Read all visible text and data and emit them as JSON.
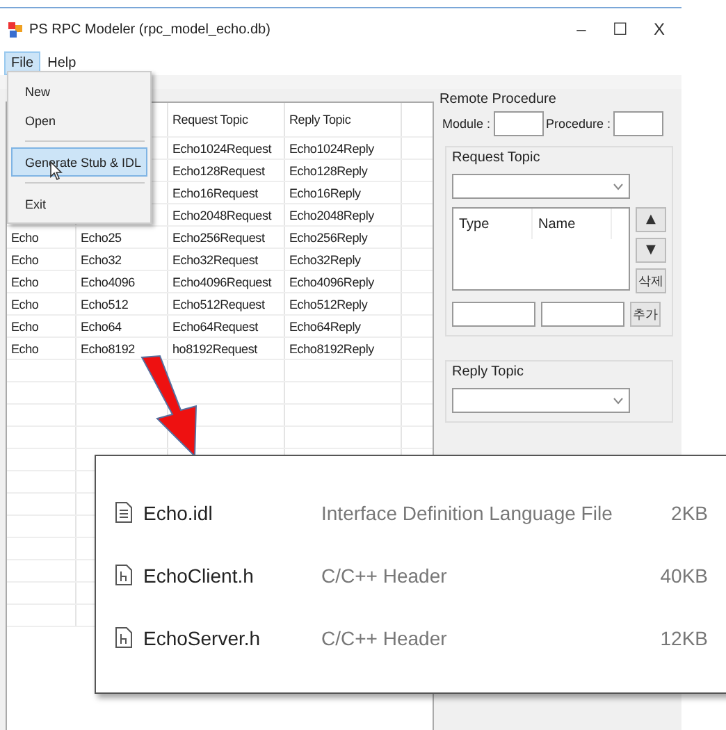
{
  "window": {
    "title": "PS RPC Modeler (rpc_model_echo.db)",
    "controls": [
      "–",
      "☐",
      "X"
    ]
  },
  "menu_bar": [
    {
      "label": "File",
      "selected": true
    },
    {
      "label": "Help",
      "selected": false
    }
  ],
  "file_menu": [
    {
      "kind": "item",
      "label": "New",
      "selected": false
    },
    {
      "kind": "item",
      "label": "Open",
      "selected": false
    },
    {
      "kind": "separator"
    },
    {
      "kind": "item",
      "label": "Generate Stub & IDL",
      "selected": true
    },
    {
      "kind": "separator"
    },
    {
      "kind": "item",
      "label": "Exit",
      "selected": false
    }
  ],
  "table": {
    "columns": [
      "Request Topic",
      "Reply Topic"
    ],
    "rows": [
      {
        "request_topic": "Echo1024Request",
        "reply_topic": "Echo1024Reply"
      },
      {
        "request_topic": "Echo128Request",
        "reply_topic": "Echo128Reply"
      },
      {
        "request_topic": "Echo16Request",
        "reply_topic": "Echo16Reply"
      },
      {
        "request_topic": "Echo2048Request",
        "reply_topic": "Echo2048Reply"
      },
      {
        "module": "Echo",
        "procedure": "Echo25",
        "request_topic": "Echo256Request",
        "reply_topic": "Echo256Reply"
      },
      {
        "module": "Echo",
        "procedure": "Echo32",
        "request_topic": "Echo32Request",
        "reply_topic": "Echo32Reply"
      },
      {
        "module": "Echo",
        "procedure": "Echo4096",
        "request_topic": "Echo4096Request",
        "reply_topic": "Echo4096Reply"
      },
      {
        "module": "Echo",
        "procedure": "Echo512",
        "request_topic": "Echo512Request",
        "reply_topic": "Echo512Reply"
      },
      {
        "module": "Echo",
        "procedure": "Echo64",
        "request_topic": "Echo64Request",
        "reply_topic": "Echo64Reply"
      },
      {
        "module": "Echo",
        "procedure": "Echo8192",
        "request_topic": "ho8192Request",
        "reply_topic": "Echo8192Reply"
      }
    ]
  },
  "remote_procedure": {
    "title": "Remote Procedure",
    "module_label": "Module :",
    "procedure_label": "Procedure :",
    "request_topic": {
      "title": "Request Topic",
      "columns": [
        "Type",
        "Name"
      ],
      "up": "▲",
      "down": "▼",
      "delete": "삭제",
      "add": "추가"
    },
    "reply_topic": {
      "title": "Reply Topic"
    }
  },
  "callout": {
    "files": [
      {
        "name": "Echo.idl",
        "type": "Interface Definition Language File",
        "size": "2KB",
        "kind": "text"
      },
      {
        "name": "EchoClient.h",
        "type": "C/C++ Header",
        "size": "40KB",
        "kind": "header"
      },
      {
        "name": "EchoServer.h",
        "type": "C/C++ Header",
        "size": "12KB",
        "kind": "header"
      }
    ]
  }
}
